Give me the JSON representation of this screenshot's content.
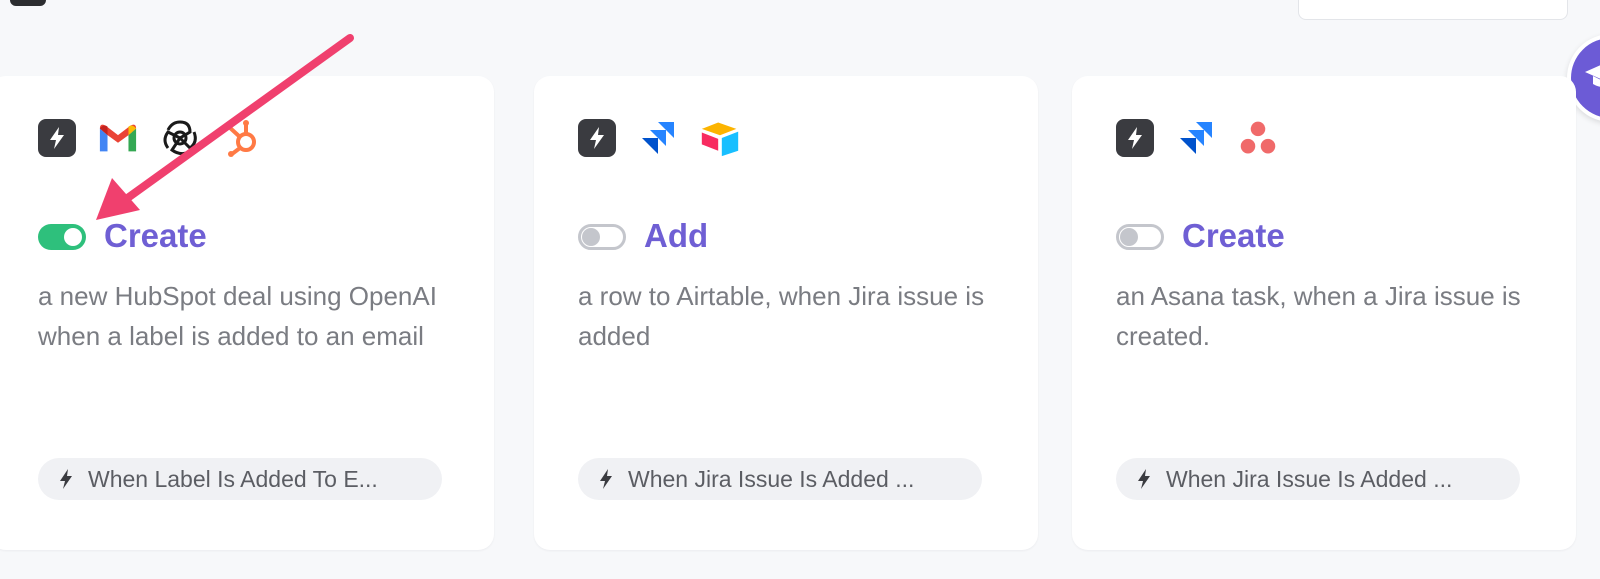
{
  "colors": {
    "accent": "#6f5fd4",
    "toggle_on": "#2ec07c",
    "toggle_off": "#c4c6cc",
    "arrow": "#f0406e"
  },
  "cards": [
    {
      "icons": [
        "lightning-icon",
        "gmail-icon",
        "openai-icon",
        "hubspot-icon"
      ],
      "enabled": true,
      "action": "Create",
      "description": "a new HubSpot deal using OpenAI when a label is added to an email",
      "trigger": "When Label Is Added To E..."
    },
    {
      "icons": [
        "lightning-icon",
        "jira-icon",
        "airtable-icon"
      ],
      "enabled": false,
      "action": "Add",
      "description": "a row to Airtable, when Jira issue is added",
      "trigger": "When Jira Issue Is Added ..."
    },
    {
      "icons": [
        "lightning-icon",
        "jira-icon",
        "asana-icon"
      ],
      "enabled": false,
      "action": "Create",
      "description": "an Asana task, when a Jira issue is created.",
      "trigger": "When Jira Issue Is Added ..."
    }
  ]
}
